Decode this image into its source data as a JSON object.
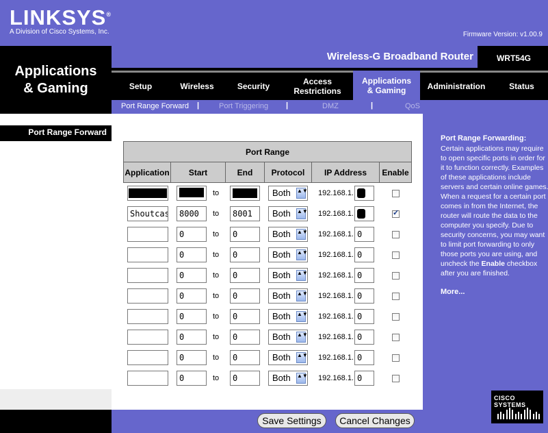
{
  "brand": {
    "logo": "LINKSYS",
    "registered": "®",
    "tagline": "A Division of Cisco Systems, Inc.",
    "firmware": "Firmware Version: v1.00.9"
  },
  "product": {
    "name": "Wireless-G Broadband Router",
    "model": "WRT54G"
  },
  "page_title": [
    "Applications",
    "& Gaming"
  ],
  "tabs": [
    {
      "label": "Setup"
    },
    {
      "label": "Wireless"
    },
    {
      "label": "Security"
    },
    {
      "label": "Access Restrictions"
    },
    {
      "label": "Applications & Gaming",
      "active": true
    },
    {
      "label": "Administration"
    },
    {
      "label": "Status"
    }
  ],
  "subtabs": [
    {
      "label": "Port Range Forward",
      "active": true
    },
    {
      "label": "Port Triggering"
    },
    {
      "label": "DMZ"
    },
    {
      "label": "QoS"
    }
  ],
  "subtab_separator": "|",
  "left_label": "Port Range Forward",
  "table": {
    "group_header": "Port Range",
    "columns": [
      "Application",
      "Start",
      "End",
      "Protocol",
      "IP Address",
      "Enable"
    ],
    "to_label": "to",
    "ip_prefix": "192.168.1.",
    "rows": [
      {
        "application": "",
        "start": "",
        "end": "",
        "protocol": "Both",
        "ip_last": "",
        "enabled": false,
        "redacted": true
      },
      {
        "application": "Shoutcast",
        "start": "8000",
        "end": "8001",
        "protocol": "Both",
        "ip_last": "",
        "enabled": true,
        "redacted_ip": true
      },
      {
        "application": "",
        "start": "0",
        "end": "0",
        "protocol": "Both",
        "ip_last": "0",
        "enabled": false
      },
      {
        "application": "",
        "start": "0",
        "end": "0",
        "protocol": "Both",
        "ip_last": "0",
        "enabled": false
      },
      {
        "application": "",
        "start": "0",
        "end": "0",
        "protocol": "Both",
        "ip_last": "0",
        "enabled": false
      },
      {
        "application": "",
        "start": "0",
        "end": "0",
        "protocol": "Both",
        "ip_last": "0",
        "enabled": false
      },
      {
        "application": "",
        "start": "0",
        "end": "0",
        "protocol": "Both",
        "ip_last": "0",
        "enabled": false
      },
      {
        "application": "",
        "start": "0",
        "end": "0",
        "protocol": "Both",
        "ip_last": "0",
        "enabled": false
      },
      {
        "application": "",
        "start": "0",
        "end": "0",
        "protocol": "Both",
        "ip_last": "0",
        "enabled": false
      },
      {
        "application": "",
        "start": "0",
        "end": "0",
        "protocol": "Both",
        "ip_last": "0",
        "enabled": false
      }
    ]
  },
  "help": {
    "title": "Port Range Forwarding:",
    "body_before": "Certain applications may require to open specific ports in order for it to function correctly. Examples of these applications include servers and certain online games. When a request for a certain port comes in from the Internet, the router will route the data to the computer you specify. Due to security concerns, you may want to limit port forwarding to only those ports you are using, and uncheck the ",
    "body_bold": "Enable",
    "body_after": " checkbox after you are finished.",
    "more": "More..."
  },
  "buttons": {
    "save": "Save Settings",
    "cancel": "Cancel Changes"
  },
  "cisco": {
    "text": "CISCO SYSTEMS"
  },
  "colors": {
    "accent": "#6666cc",
    "black": "#000000",
    "header_gray": "#cccccc"
  }
}
